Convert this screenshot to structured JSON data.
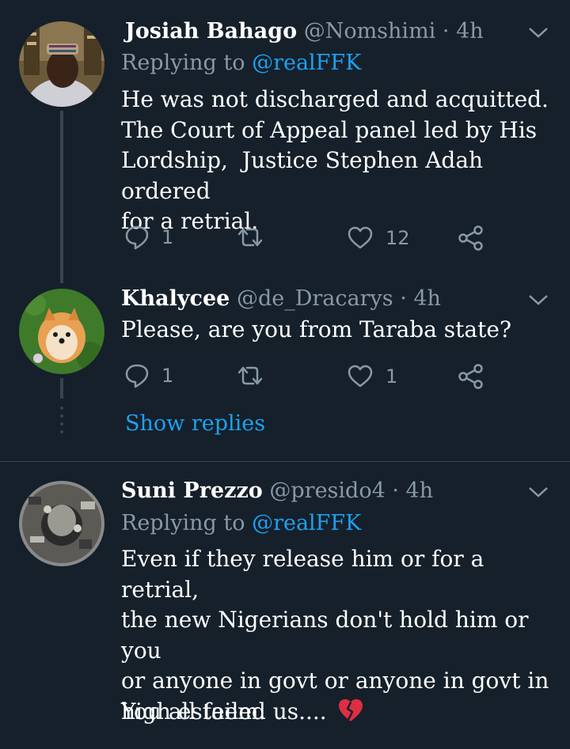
{
  "tweets": [
    {
      "name": "Josiah Bahago",
      "handle": "@Nomshimi",
      "time": "· 4h",
      "replying_prefix": "Replying to ",
      "replying_to": "@realFFK",
      "text": "He was not discharged and acquitted.\nThe Court of Appeal panel led by His\nLordship,  Justice Stephen Adah ordered\nfor a retrial.",
      "replies": "1",
      "retweets": "",
      "likes": "12"
    },
    {
      "name": "Khalycee",
      "handle": "@de_Dracarys",
      "time": "· 4h",
      "text": "Please, are you from Taraba state?",
      "replies": "1",
      "retweets": "",
      "likes": "1"
    },
    {
      "name": "Suni Prezzo",
      "handle": "@presido4",
      "time": "· 4h",
      "replying_prefix": "Replying to ",
      "replying_to": "@realFFK",
      "text": "Even if they release him or for a retrial,\nthe new Nigerians don't hold him or you\nor anyone in govt or anyone in govt in\nhigh esteem.",
      "text2": "You all failed us....",
      "emoji": "💔"
    }
  ],
  "show_replies": "Show replies",
  "colors": {
    "background": "#15202b",
    "muted": "#8899a6",
    "link": "#1da1f2",
    "divider": "#38444d"
  },
  "icons": [
    "reply-icon",
    "retweet-icon",
    "like-icon",
    "share-icon",
    "chevron-down-icon",
    "broken-heart-emoji"
  ]
}
